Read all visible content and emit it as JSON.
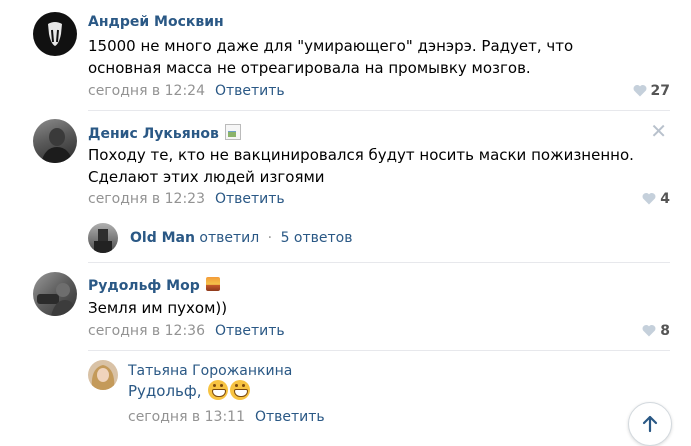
{
  "comments": [
    {
      "author": "Андрей Москвин",
      "text": "15000 не много даже для \"умирающего\" дэнэрэ. Радует, что основная масса не отреагировала на промывку мозгов.",
      "time": "сегодня в 12:24",
      "reply_label": "Ответить",
      "likes": "27"
    },
    {
      "author": "Денис Лукьянов",
      "text": "Походу те, кто не вакцинировался будут носить маски пожизненно. Сделают этих людей изгоями",
      "time": "сегодня в 12:23",
      "reply_label": "Ответить",
      "likes": "4",
      "close_symbol": "✕",
      "thread": {
        "replier": "Old Man",
        "replied_label": "ответил",
        "dot": "·",
        "count_label": "5 ответов"
      }
    },
    {
      "author": "Рудольф Мор",
      "text": "Земля им пухом))",
      "time": "сегодня в 12:36",
      "reply_label": "Ответить",
      "likes": "8",
      "reply": {
        "author": "Татьяна Горожанкина",
        "text": "Рудольф,",
        "time": "сегодня в 13:11",
        "reply_label": "Ответить"
      }
    }
  ],
  "icons": {
    "like": "heart-icon",
    "scroll": "arrow-up-icon"
  },
  "colors": {
    "link": "#2a5885",
    "meta": "#939393",
    "divider": "#e7e8ec"
  }
}
